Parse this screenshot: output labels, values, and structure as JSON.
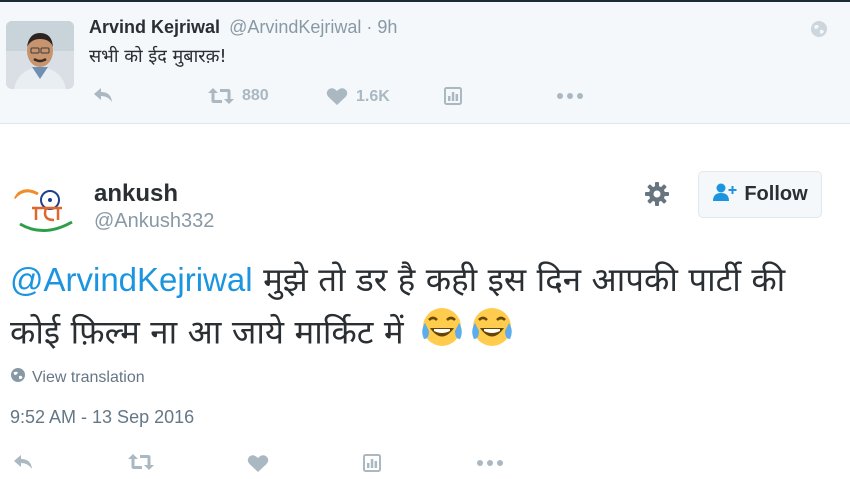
{
  "quoted_tweet": {
    "author_name": "Arvind Kejriwal",
    "handle": "@ArvindKejriwal",
    "time": "· 9h",
    "text": "सभी को ईद मुबारक़!",
    "actions": {
      "retweet_count": "880",
      "like_count": "1.6K"
    }
  },
  "tweet": {
    "author_name": "ankush",
    "handle": "@Ankush332",
    "follow_label": "Follow",
    "mention": "@ArvindKejriwal",
    "text": " मुझे तो डर है कही इस दिन आपकी पार्टी की कोई फ़िल्म ना आ जाये मार्किट में",
    "view_translation": "View translation",
    "timestamp": "9:52 AM - 13 Sep 2016"
  },
  "colors": {
    "link": "#1b95e0",
    "muted": "#8899a6",
    "action_gray": "#aab8c2",
    "text": "#292f33"
  },
  "icons": [
    "reply-icon",
    "retweet-icon",
    "like-icon",
    "analytics-icon",
    "more-icon",
    "globe-icon",
    "gear-icon",
    "follow-person-icon",
    "tears-of-joy-emoji"
  ]
}
